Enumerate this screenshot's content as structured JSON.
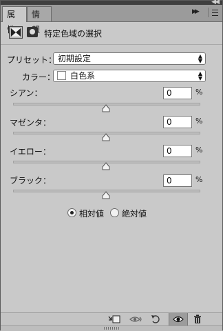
{
  "tabs": [
    {
      "label": "属性",
      "active": true
    },
    {
      "label": "情報",
      "active": false
    }
  ],
  "header": {
    "title": "特定色域の選択"
  },
  "preset": {
    "label": "プリセット：",
    "value": "初期設定"
  },
  "colors": {
    "label": "カラー：",
    "value": "白色系",
    "swatch": "#ffffff"
  },
  "sliders": [
    {
      "label": "シアン：",
      "value": "0",
      "unit": "%"
    },
    {
      "label": "マゼンタ：",
      "value": "0",
      "unit": "%"
    },
    {
      "label": "イエロー：",
      "value": "0",
      "unit": "%"
    },
    {
      "label": "ブラック：",
      "value": "0",
      "unit": "%"
    }
  ],
  "method": {
    "relative_label": "相対値",
    "absolute_label": "絶対値",
    "selected": "relative"
  },
  "footer_icons": [
    "clip-to-layer-icon",
    "view-previous-state-icon",
    "reset-icon",
    "visibility-eye-icon",
    "trash-icon"
  ]
}
